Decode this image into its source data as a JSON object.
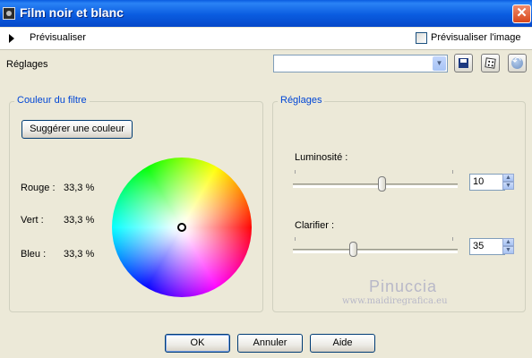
{
  "window": {
    "title": "Film noir et blanc"
  },
  "preview": {
    "label": "Prévisualiser",
    "checkbox_label": "Prévisualiser l'image",
    "checked": false
  },
  "presets": {
    "label": "Réglages",
    "selected": ""
  },
  "filter_group": {
    "title": "Couleur du filtre",
    "suggest_button": "Suggérer une couleur",
    "rows": [
      {
        "label": "Rouge :",
        "value": "33,3 %"
      },
      {
        "label": "Vert :",
        "value": "33,3 %"
      },
      {
        "label": "Bleu :",
        "value": "33,3 %"
      }
    ]
  },
  "settings_group": {
    "title": "Réglages",
    "brightness": {
      "label": "Luminosité :",
      "value": "10",
      "slider_fraction": 0.54
    },
    "clarify": {
      "label": "Clarifier :",
      "value": "35",
      "slider_fraction": 0.36
    }
  },
  "watermark": {
    "name": "Pinuccia",
    "url": "www.maidiregrafica.eu"
  },
  "buttons": {
    "ok": "OK",
    "cancel": "Annuler",
    "help": "Aide"
  },
  "icons": {
    "window": "app-icon",
    "close": "close-icon",
    "expand": "triangle-right-icon",
    "save": "save-icon",
    "random": "dice-icon",
    "reset": "reset-icon"
  }
}
